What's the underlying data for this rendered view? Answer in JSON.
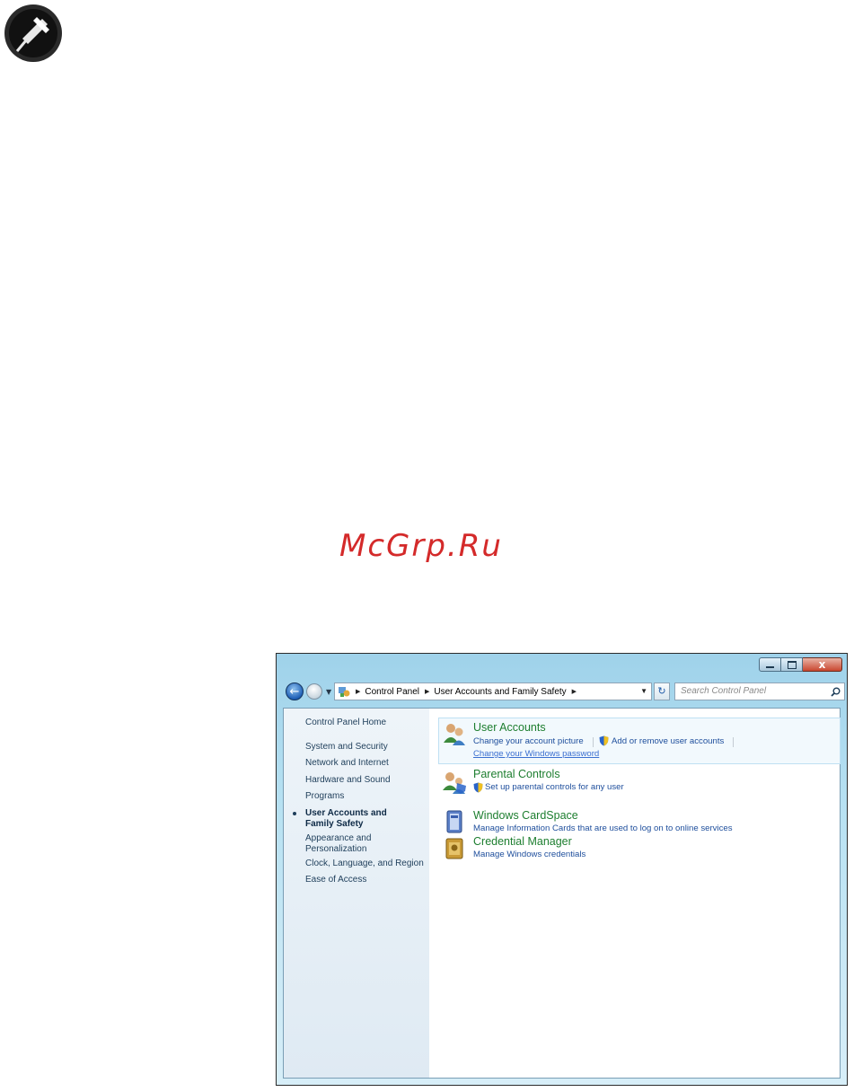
{
  "watermark": "McGrp.Ru",
  "window": {
    "caption_buttons": {
      "close": "x"
    },
    "nav": {
      "breadcrumbs": [
        "Control Panel",
        "User Accounts and Family Safety"
      ],
      "search_placeholder": "Search Control Panel"
    },
    "sidebar": {
      "home": "Control Panel Home",
      "items": [
        "System and Security",
        "Network and Internet",
        "Hardware and Sound",
        "Programs",
        "User Accounts and Family Safety",
        "Appearance and Personalization",
        "Clock, Language, and Region",
        "Ease of Access"
      ],
      "active_item": "User Accounts and Family Safety"
    },
    "categories": [
      {
        "title": "User Accounts",
        "links": [
          "Change your account picture",
          "Add or remove user accounts",
          "Change your Windows password"
        ]
      },
      {
        "title": "Parental Controls",
        "links": [
          "Set up parental controls for any user"
        ]
      },
      {
        "title": "Windows CardSpace",
        "links": [
          "Manage Information Cards that are used to log on to online services"
        ]
      },
      {
        "title": "Credential Manager",
        "links": [
          "Manage Windows credentials"
        ]
      }
    ]
  },
  "colors": {
    "category_title": "#1d7e2f",
    "link": "#1e4e9c",
    "watermark": "#d42a2a"
  }
}
